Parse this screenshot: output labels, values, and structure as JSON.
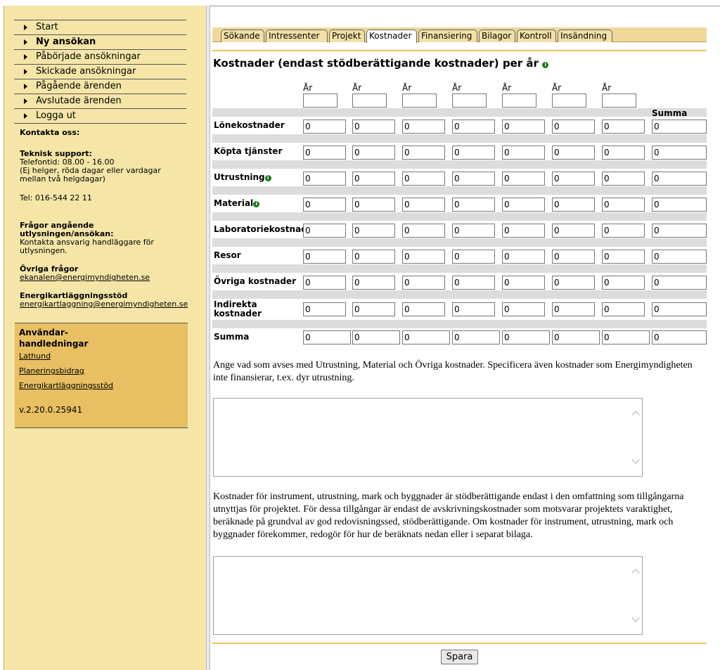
{
  "nav": [
    "Start",
    "Ny ansökan",
    "Påbörjade ansökningar",
    "Skickade ansökningar",
    "Pågående ärenden",
    "Avslutade ärenden",
    "Logga ut"
  ],
  "contact": {
    "heading": "Kontakta oss:",
    "support_title": "Teknisk support:",
    "support_lines": [
      "Telefontid: 08.00 - 16.00",
      "(Ej helger, röda dagar eller vardagar",
      "mellan två helgdagar)"
    ],
    "tel": "Tel: 016-544 22 11",
    "questions_title_1": "Frågor angående",
    "questions_title_2": "utlysningen/ansökan:",
    "questions_lines": [
      "Kontakta ansvarig handläggare för",
      "utlysningen."
    ],
    "other_title": "Övriga frågor",
    "other_email": "ekanalen@energimyndigheten.se",
    "ek_title": "Energikartläggningsstöd",
    "ek_email": "energikartlaggning@energimyndigheten.se"
  },
  "guides": {
    "title_1": "Användar-",
    "title_2": "handledningar",
    "links": [
      "Lathund",
      "Planeringsbidrag",
      "Energikartläggningsstöd"
    ],
    "version": "v.2.20.0.25941"
  },
  "tabs": [
    "Sökande",
    "Intressenter",
    "Projekt",
    "Kostnader",
    "Finansiering",
    "Bilagor",
    "Kontroll",
    "Insändning"
  ],
  "active_tab": "Kostnader",
  "page_title": "Kostnader (endast stödberättigande kostnader) per år",
  "year_label": "År",
  "sum_label": "Summa",
  "rows": [
    {
      "label": "Lönekostnader",
      "info": false,
      "values": [
        "0",
        "0",
        "0",
        "0",
        "0",
        "0",
        "0",
        "0"
      ]
    },
    {
      "label": "Köpta tjänster",
      "info": false,
      "values": [
        "0",
        "0",
        "0",
        "0",
        "0",
        "0",
        "0",
        "0"
      ]
    },
    {
      "label": "Utrustning",
      "info": true,
      "values": [
        "0",
        "0",
        "0",
        "0",
        "0",
        "0",
        "0",
        "0"
      ]
    },
    {
      "label": "Material",
      "info": true,
      "values": [
        "0",
        "0",
        "0",
        "0",
        "0",
        "0",
        "0",
        "0"
      ]
    },
    {
      "label": "Laboratoriekostnad",
      "info": false,
      "values": [
        "0",
        "0",
        "0",
        "0",
        "0",
        "0",
        "0",
        "0"
      ]
    },
    {
      "label": "Resor",
      "info": false,
      "values": [
        "0",
        "0",
        "0",
        "0",
        "0",
        "0",
        "0",
        "0"
      ]
    },
    {
      "label": "Övriga kostnader",
      "info": false,
      "values": [
        "0",
        "0",
        "0",
        "0",
        "0",
        "0",
        "0",
        "0"
      ]
    },
    {
      "label": "Indirekta kostnader",
      "info": false,
      "values": [
        "0",
        "0",
        "0",
        "0",
        "0",
        "0",
        "0",
        "0"
      ]
    },
    {
      "label": "Summa",
      "info": false,
      "values": [
        "0",
        "0",
        "0",
        "0",
        "0",
        "0",
        "0",
        "0"
      ]
    }
  ],
  "text1": "Ange vad som avses med Utrustning, Material och Övriga kostnader. Specificera även kostnader som Energimyndigheten inte finansierar, t.ex. dyr utrustning.",
  "text2": "Kostnader för instrument, utrustning, mark och byggnader är stödberättigande endast i den omfattning som tillgångarna utnyttjas för projektet. För dessa tillgångar är endast de avskrivningskostnader som motsvarar projektets varaktighet, beräknade på grundval av god redovisningssed, stödberättigande. Om kostnader för instrument, utrustning, mark och byggnader förekommer, redogör för hur de beräknats nedan eller i separat bilaga.",
  "save_label": "Spara"
}
